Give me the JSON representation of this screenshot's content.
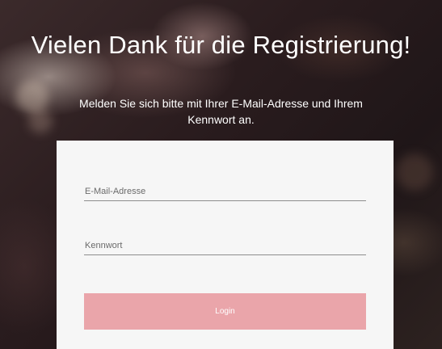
{
  "page": {
    "title": "Vielen Dank für die Registrierung!",
    "subtitle": "Melden Sie sich bitte mit Ihrer E-Mail-Adresse und Ihrem Kennwort an."
  },
  "form": {
    "email_placeholder": "E-Mail-Adresse",
    "email_value": "",
    "password_placeholder": "Kennwort",
    "password_value": "",
    "login_label": "Login"
  },
  "colors": {
    "button_background": "#eaa5aa",
    "card_background": "#f6f6f6",
    "text_on_dark": "#ffffff"
  }
}
